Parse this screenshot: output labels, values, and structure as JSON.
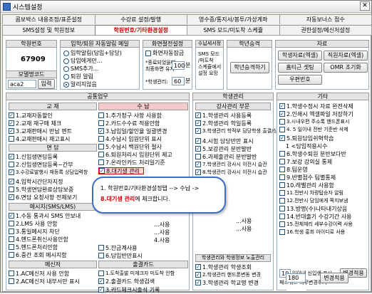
{
  "window": {
    "title": "시스템설정"
  },
  "tabs_row1": [
    "콤보박스 내용조정/표준설정",
    "수강료 설정/발행",
    "영수증/통지서/봉투/가상계좌",
    "자동보너스 점수"
  ],
  "tabs_row2": [
    "SMS설정 및 학원정보",
    "학원번호/기타환경설정",
    "SMS 모드/미도착 스케쥴",
    "권한설정/메신저설정"
  ],
  "active_tab_index": 1,
  "top": {
    "academy_no": {
      "head": "학원번호",
      "value": "67909",
      "model_code_label": "모델명코드",
      "model_code_value": "aca2",
      "input_button": "입력"
    },
    "entry": {
      "head": "입학/퇴원 자동알림 메일",
      "radios": [
        "입학알림(담임+담당)",
        "담임에게만...",
        "SMS추가...",
        "퇴원 알림",
        "알리지않음"
      ],
      "selected_index": 4
    },
    "screen_save": {
      "head": "화면절전설정",
      "auto_end_label": "화면자동잠금",
      "recent_label": "*종료되었을때",
      "recent_label2": "최종화면 유지",
      "minutes_value": "100",
      "minutes_unit": "분",
      "count_label": "*학생관리:",
      "count_value": "60",
      "count_unit": "분"
    },
    "check_setting": {
      "head": "수납세서정",
      "lines": [
        "SMS 모드",
        "/미도착",
        "스케쥴에서",
        "설정 요망"
      ]
    },
    "grade": {
      "head": "학년승격",
      "button": "학년승격하기"
    },
    "data": {
      "head": "자료",
      "buttons": [
        "학생자료(엑셀)",
        "직원자료(엑셀)",
        "홈티근 셋팅",
        "OMR 초기화",
        "우편번호"
      ]
    }
  },
  "sections": {
    "common": {
      "head": "공통업무"
    },
    "teach": {
      "head": "교 재",
      "items": [
        "1.교재자동할인",
        "2.교재 재구매 체크",
        "3.교재판매시 반납 멘트",
        "4.교재판매시 재고표시"
      ]
    },
    "interview": {
      "head": "면 담",
      "items": [
        "1.신입생면담등록",
        "2.신입생면담등록~간부",
        "3.수강료발행시 재등록 상담입력창",
        "4.입학시간단자지정",
        "5.학생면담완료상담보증",
        "6.면담 요청사항 전체보기"
      ]
    },
    "message": {
      "head": "메시지(SMS/LMS)",
      "items": [
        "1.수동 통과시 SMS 안보내",
        "2.LMS 사용 안함",
        "3.통일메시지 차단",
        "4.핸드폰취신사용안함",
        "5.핸드폰처리안함",
        "6.중간 조회 메시지함"
      ]
    },
    "messenger": {
      "head": "메신저",
      "items": [
        "1.AC메신저 사용 안함",
        "2.AC메신저 내부서만 표시"
      ]
    },
    "payment": {
      "head": "수 납",
      "items": [
        "1.추가청구 사항 사용함",
        "2.카드수수료 적용안함",
        "3.납입일/할인율 일괄변경",
        "4.수납시 입원단위 표시",
        "5.수납시 백원단위 절사",
        "6.퇴원처리시 입원단위 제고",
        "7.온라인카드 처리일기준",
        "8.대기생 관리"
      ]
    },
    "payment_more": {
      "items": [
        "...사용",
        "...사용",
        "4.사용",
        "5.잔금계사용",
        "6.담임반만표시"
      ]
    },
    "attendance": {
      "head": "출결카드",
      "items": [
        "1.도착출발 미체크자 미도착 안함",
        "2.출결카드 학생검색",
        "3.카드체크시출석 기록",
        "4.모바일 출석기록시 즉시 SMS"
      ]
    },
    "student_mgmt": {
      "head": "학생관리"
    },
    "teacher": {
      "head": "강사관리 부문",
      "items": [
        "1.학생관리 사용등록",
        "2.학생관리 학일등록",
        "3.학생관리 학적부 담당학생 출결/상담 자동 모양",
        "4.시험 담당반만 표시",
        "5.보강관리 분반발반",
        "6.과제출관리 분반발반",
        "7.학생관리 강사시 이전시 습관",
        "8.학생관리 강사시 이전시 습관"
      ]
    },
    "student_side": {
      "items": [
        "...",
        "...",
        "...사용",
        "...사용"
      ]
    },
    "teacher_admin": {
      "head": "학생관리와 학생정보 노출관리",
      "items": [
        "1.학생관리 학생조회",
        "2.학생관리 핸드폰변동 변경",
        "3.학생관리 학교명 변경",
        "4.학생관리 학적부 미납/수납 항목 처리",
        "5.학생관리 전화번호 숨김",
        "6.학생관리 가상계좌 표시"
      ]
    },
    "etc": {
      "head": "기타",
      "items": [
        "1.학생수정시 자료 완전삭제",
        "2.인쇄시 엑셀파일 저장하기",
        "3.시내우편 주소록 핸드폰표시",
        "4. 5 일이내 전반 기준반 삭제",
        "5.퇴원담임쉬혁학습",
        "1 <담임적용시수",
        "6.학생수퇴원 분반보다반",
        "7.보강 강의실 통제",
        "8.팀운영",
        "9.반별점수 팀별통제",
        "10.레벨관리 사용함",
        "11.전반시 차량탑승자 알림",
        "12.전반시 담임에게 쪽지보냄",
        "13.방명(수)나타내기상음",
        "14.반대출기 수강기간 사용",
        "15.전체체리 세부수강이력 사용",
        "16.학생 홍회 아이디로 사용"
      ],
      "new_student_label": "일이내 신입생 표시",
      "new_student_value": "10",
      "new_student_button": "변경적용",
      "password_label": "패스워드 의무변경주기",
      "password_value": "180",
      "password_button": "변경적용"
    }
  },
  "callout": {
    "line1": "1. 학원번호/기타환경설정탭 --> 수납 ->",
    "line2_red": "8.대기생 관리",
    "line2_rest": "에 체크합니다."
  }
}
